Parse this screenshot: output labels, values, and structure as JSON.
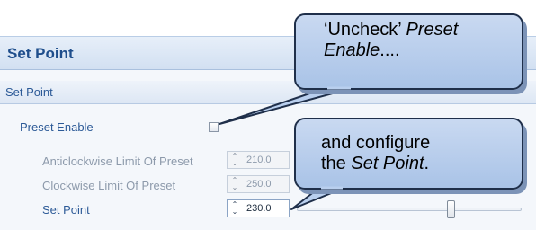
{
  "panel": {
    "title": "Set Point"
  },
  "group": {
    "title": "Set Point"
  },
  "rows": {
    "preset_enable": {
      "label": "Preset Enable",
      "checked": false
    },
    "anticlockwise": {
      "label": "Anticlockwise Limit Of Preset",
      "value": "210.0",
      "enabled": false
    },
    "clockwise": {
      "label": "Clockwise Limit Of Preset",
      "value": "250.0",
      "enabled": false
    },
    "set_point": {
      "label": "Set Point",
      "value": "230.0",
      "enabled": true
    }
  },
  "slider": {
    "value": 230.0
  },
  "callouts": {
    "first": {
      "line1": "‘Uncheck’ ",
      "emph1": "Preset",
      "emph2": "Enable",
      "tail": "...."
    },
    "second": {
      "line1": "and configure",
      "prefix": "the ",
      "emph": "Set Point",
      "tail": "."
    }
  },
  "colors": {
    "header_text": "#1f4e8c",
    "label_text": "#2c5a97",
    "disabled_text": "#8d9aab",
    "callout_fill": "#b9cfee",
    "callout_border": "#1f2f4a"
  }
}
